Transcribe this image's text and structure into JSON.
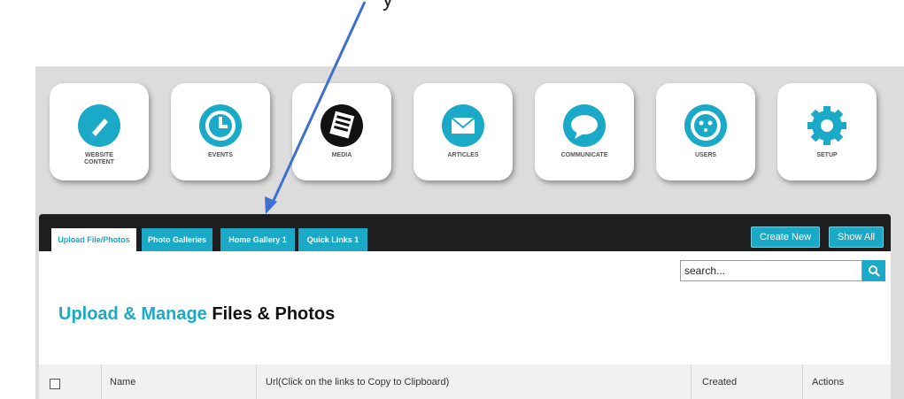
{
  "top_text": "y",
  "nav": [
    {
      "label": "WEBSITE\nCONTENT",
      "icon": "pencil-icon"
    },
    {
      "label": "EVENTS",
      "icon": "clock-icon"
    },
    {
      "label": "MEDIA",
      "icon": "media-icon"
    },
    {
      "label": "ARTICLES",
      "icon": "envelope-icon"
    },
    {
      "label": "COMMUNICATE",
      "icon": "speech-bubble-icon"
    },
    {
      "label": "USERS",
      "icon": "user-face-icon"
    },
    {
      "label": "SETUP",
      "icon": "gear-icon"
    }
  ],
  "tabs": [
    {
      "label": "Upload File/Photos",
      "active": true
    },
    {
      "label": "Photo Galleries",
      "active": false
    },
    {
      "label": "Home Gallery 1",
      "active": false
    },
    {
      "label": "Quick Links 1",
      "active": false
    }
  ],
  "buttons": {
    "create_new": "Create New",
    "show_all": "Show All"
  },
  "search": {
    "value": "search..."
  },
  "page_title": {
    "highlight": "Upload & Manage",
    "rest": "Files & Photos"
  },
  "table": {
    "headers": [
      "Name",
      "Url(Click on the links to Copy to Clipboard)",
      "Created",
      "Actions"
    ]
  },
  "colors": {
    "accent": "#1aa9c7",
    "dark_bar": "#1e1e1e",
    "annotation_arrow": "#3f6fd1"
  }
}
